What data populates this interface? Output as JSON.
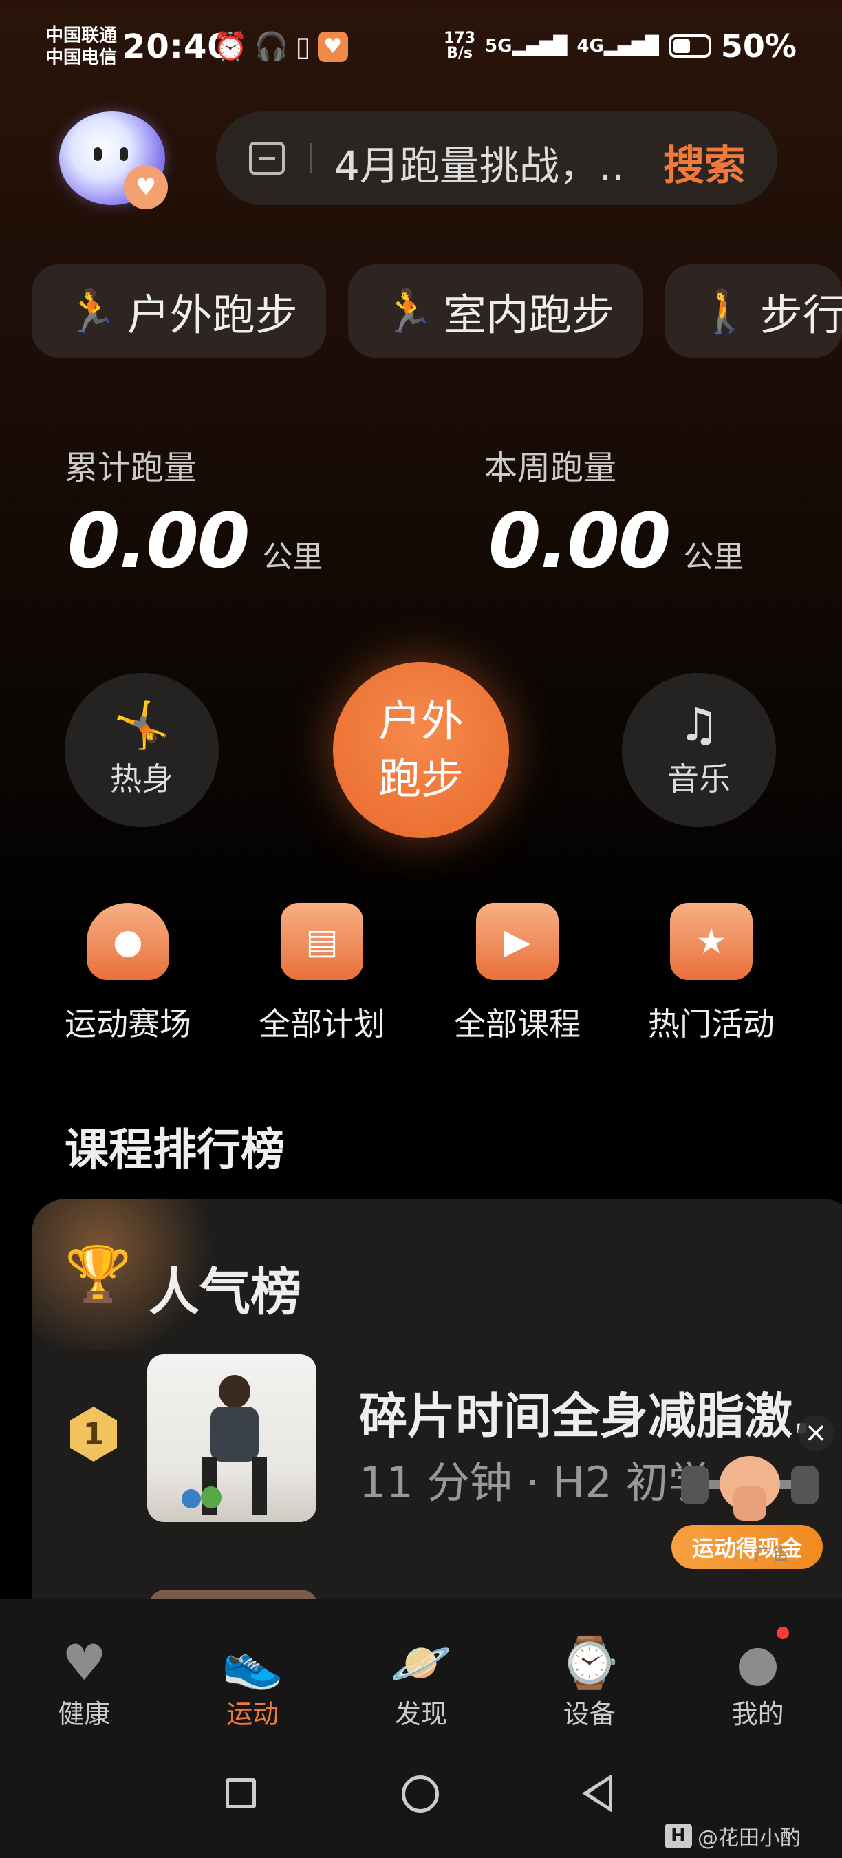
{
  "status_bar": {
    "carrier_1": "中国联通",
    "carrier_2": "中国电信",
    "time": "20:40",
    "net_speed_value": "173",
    "net_speed_unit": "B/s",
    "signal_1": "5G",
    "signal_2": "4G",
    "battery_percent": "50%",
    "battery_level": 0.5
  },
  "search": {
    "text": "4月跑量挑战，...",
    "button": "搜索"
  },
  "modes": [
    {
      "icon": "🏃",
      "label": "户外跑步"
    },
    {
      "icon": "🏃",
      "label": "室内跑步"
    },
    {
      "icon": "🚶",
      "label": "步行"
    }
  ],
  "stats": {
    "total": {
      "label": "累计跑量",
      "value": "0.00",
      "unit": "公里"
    },
    "weekly": {
      "label": "本周跑量",
      "value": "0.00",
      "unit": "公里"
    }
  },
  "actions": {
    "warmup": "热身",
    "start_line1": "户外",
    "start_line2": "跑步",
    "music": "音乐"
  },
  "quick_entries": [
    {
      "label": "运动赛场",
      "icon": "location-pin-icon"
    },
    {
      "label": "全部计划",
      "icon": "clipboard-icon"
    },
    {
      "label": "全部课程",
      "icon": "video-play-icon"
    },
    {
      "label": "热门活动",
      "icon": "star-flag-icon"
    }
  ],
  "ranking": {
    "section_title": "课程排行榜",
    "card_title": "人气榜",
    "items": [
      {
        "rank": "1",
        "title": "碎片时间全身减脂激...",
        "meta": "11 分钟 · H2 初学"
      }
    ]
  },
  "ad": {
    "button": "运动得现金",
    "label": "广告"
  },
  "nav": [
    {
      "label": "健康",
      "icon": "heart-icon"
    },
    {
      "label": "运动",
      "icon": "running-shoe-icon"
    },
    {
      "label": "发现",
      "icon": "planet-icon"
    },
    {
      "label": "设备",
      "icon": "watch-icon"
    },
    {
      "label": "我的",
      "icon": "profile-icon"
    }
  ],
  "watermark": {
    "logo": "H",
    "text": "@花田小酌"
  },
  "colors": {
    "accent": "#f07a3c",
    "background": "#000000",
    "card": "#1e1d1c"
  }
}
